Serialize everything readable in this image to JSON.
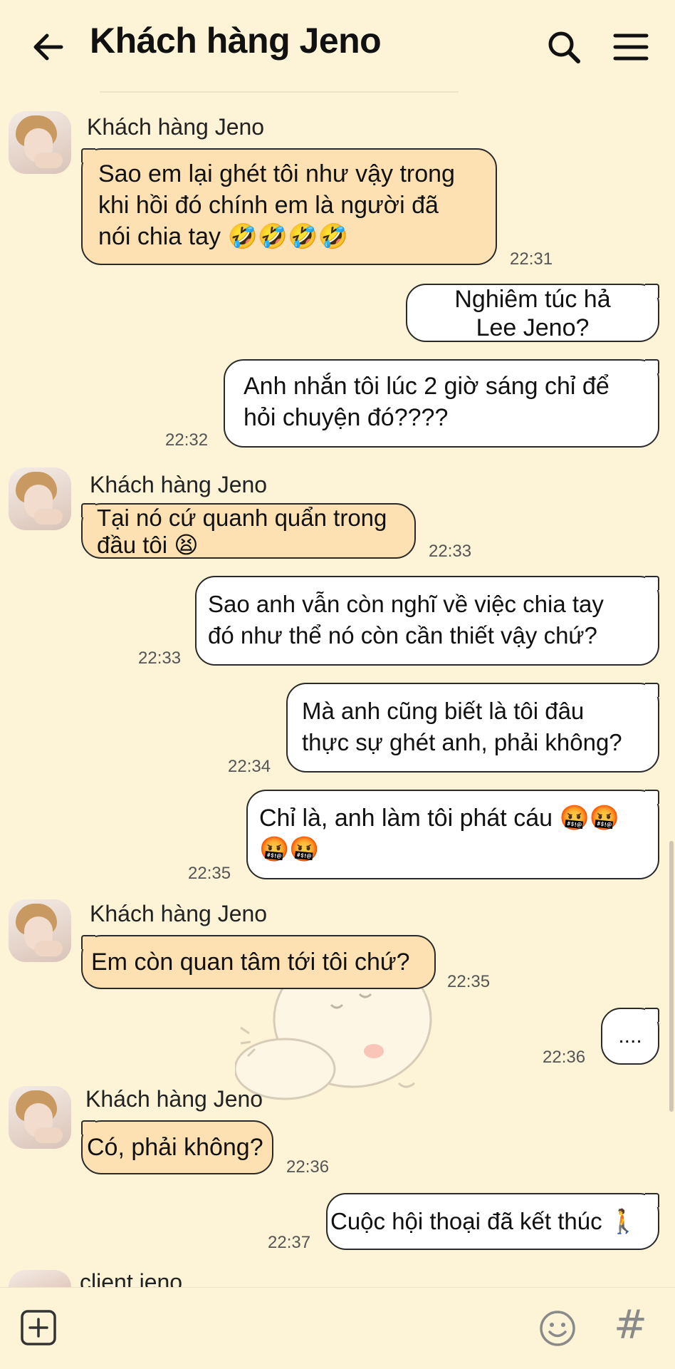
{
  "header": {
    "title": "Khách hàng Jeno",
    "back_icon": "arrow-left-icon",
    "search_icon": "search-icon",
    "menu_icon": "hamburger-menu-icon"
  },
  "messages": [
    {
      "sender": "Khách hàng Jeno",
      "text_lines": [
        "Sao em lại ghét tôi như vậy trong",
        "khi hồi đó chính em là người đã",
        "nói chia tay 🤣🤣🤣🤣"
      ],
      "time": "22:31",
      "direction": "in"
    },
    {
      "text_lines": [
        "Nghiêm túc hả",
        "Lee Jeno?"
      ],
      "direction": "out"
    },
    {
      "text_lines": [
        "Anh nhắn tôi lúc 2 giờ sáng chỉ để",
        "hỏi chuyện đó????"
      ],
      "time": "22:32",
      "direction": "out"
    },
    {
      "sender": "Khách hàng Jeno",
      "text_lines": [
        "Tại nó cứ quanh quẩn trong",
        "đầu tôi 😫"
      ],
      "time": "22:33",
      "direction": "in"
    },
    {
      "text_lines": [
        "Sao anh vẫn còn nghĩ về việc chia tay",
        "đó như thể nó còn cần thiết vậy chứ?"
      ],
      "time": "22:33",
      "direction": "out"
    },
    {
      "text_lines": [
        "Mà anh cũng biết là tôi đâu",
        "thực sự ghét anh, phải không?"
      ],
      "time": "22:34",
      "direction": "out"
    },
    {
      "text_lines": [
        "Chỉ là, anh làm tôi phát cáu 🤬🤬",
        "🤬🤬"
      ],
      "time": "22:35",
      "direction": "out"
    },
    {
      "sender": "Khách hàng Jeno",
      "text_lines": [
        "Em còn quan tâm tới tôi chứ?"
      ],
      "time": "22:35",
      "direction": "in"
    },
    {
      "text_lines": [
        "...."
      ],
      "time": "22:36",
      "direction": "out"
    },
    {
      "sender": "Khách hàng Jeno",
      "text_lines": [
        "Có, phải không?"
      ],
      "time": "22:36",
      "direction": "in"
    },
    {
      "text_lines": [
        "Cuộc hội thoại đã kết thúc 🚶"
      ],
      "time": "22:37",
      "direction": "out"
    }
  ],
  "next_sender": "client jeno",
  "footer": {
    "add_icon": "plus-square-icon",
    "emoji_icon": "smiley-icon",
    "hash_label": "#"
  },
  "colors": {
    "background": "#fdf3d6",
    "incoming_bubble": "#fde1b3",
    "outgoing_bubble": "#ffffff",
    "bubble_border": "#2a2a2a"
  }
}
